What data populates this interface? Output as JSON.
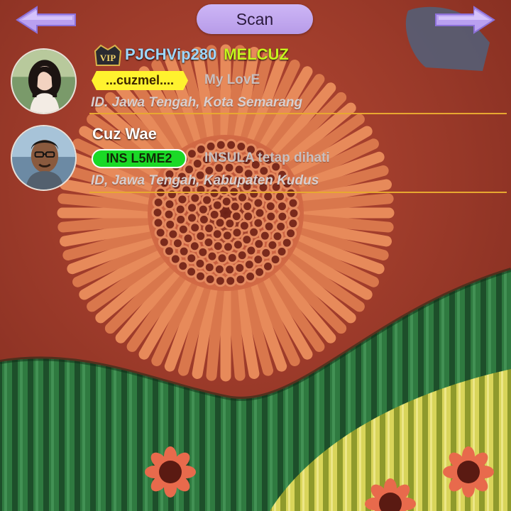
{
  "topbar": {
    "scan_label": "Scan",
    "back_icon": "left-arrow-icon",
    "forward_icon": "right-arrow-icon"
  },
  "users": [
    {
      "vip": true,
      "vip_name": "PJCHVip280",
      "nickname": "MELCUZ",
      "tag": "...cuzmel....",
      "status": "My LovE",
      "location": "ID. Jawa Tengah, Kota Semarang"
    },
    {
      "vip": false,
      "name": "Cuz Wae",
      "tag": "INS  L5ME2",
      "status": "INSULA tetap dihati",
      "location": "ID, Jawa Tengah, Kabupaten Kudus"
    }
  ],
  "colors": {
    "scan_button": "#c4aaf2",
    "divider": "#e8a830",
    "nickname": "#c6f51d",
    "vip_name": "#9ed8ff",
    "tag_yellow": "#fff22e",
    "tag_green": "#1ad926",
    "background": "#9e3a2a"
  }
}
